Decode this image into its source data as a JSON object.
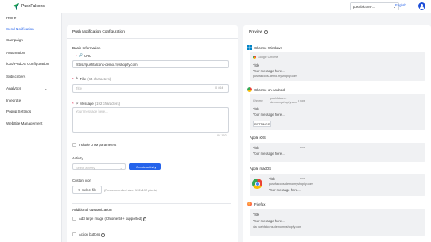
{
  "app": {
    "name": "PushFalcons"
  },
  "topbar": {
    "store": "pushfalcons-...",
    "language": "English"
  },
  "sidebar": {
    "items": [
      {
        "label": "Home"
      },
      {
        "label": "Send Notification"
      },
      {
        "label": "Campaign"
      },
      {
        "label": "Automation"
      },
      {
        "label": "iOS/iPadOS Configuration"
      },
      {
        "label": "Subscribers"
      },
      {
        "label": "Analytics"
      },
      {
        "label": "Integrate"
      },
      {
        "label": "Popup Settings"
      },
      {
        "label": "WebSite Management"
      }
    ]
  },
  "form": {
    "title": "Push Notification Configuration",
    "basic_info": "Basic Information",
    "url": {
      "label": "URL",
      "value": "https://pushfalcons-demo.myshopify.com"
    },
    "title_field": {
      "label": "Title",
      "hint": "(64 characters)",
      "placeholder": "Title",
      "counter": "0 / 64"
    },
    "message": {
      "label": "Message",
      "hint": "(192 characters)",
      "placeholder": "Your message here...",
      "counter": "0 / 192"
    },
    "utm": {
      "label": "Include UTM parameters"
    },
    "activity": {
      "label": "Activity",
      "placeholder": "Select activity",
      "create_label": "+ Create activity"
    },
    "icon": {
      "label": "Custom icon",
      "button": "Select file",
      "hint": "(Recommended size: 192x192 pixels)"
    },
    "additional": "Additional customization",
    "large_image": {
      "label": "Add large image (Chrome 56+ supported)"
    },
    "action_buttons": {
      "label": "Action buttons"
    }
  },
  "preview": {
    "title": "Preview",
    "chrome_windows": {
      "platform": "Chrome Windows",
      "browser": "Google Chrome",
      "title": "Title",
      "message": "Your message here...",
      "url": "pushfalcons-demo.myshopify.com"
    },
    "chrome_android": {
      "platform": "Chrome on Android",
      "browser": "Chrome",
      "source": "pushfalcons-demo.myshopify.com",
      "time": "• now",
      "title": "Title",
      "message": "Your message here...",
      "settings": "SETTINGS"
    },
    "apple_ios": {
      "platform": "Apple iOS",
      "title": "Title",
      "time": "now",
      "message": "Your message here..."
    },
    "apple_macos": {
      "platform": "Apple macOS",
      "title": "Title",
      "time": "now",
      "url": "pushfalcons-demo.myshopify.com",
      "message": "Your message here..."
    },
    "firefox": {
      "platform": "Firefox",
      "title": "Title",
      "message": "Your message here...",
      "url": "via pushfalcons-demo.myshopify.com"
    }
  },
  "colors": {
    "accent": "#2563eb",
    "required": "#e11d48"
  }
}
